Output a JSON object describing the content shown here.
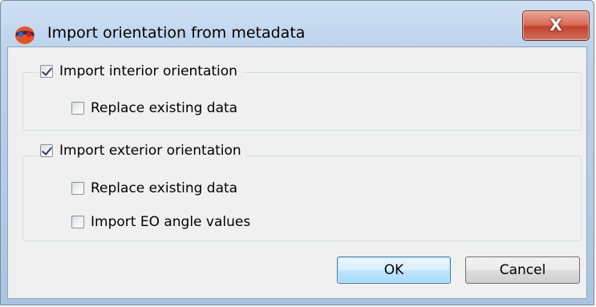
{
  "window": {
    "title": "Import orientation from metadata",
    "close_label": "X"
  },
  "groups": {
    "interior": {
      "label": "Import interior orientation",
      "checked": true,
      "options": [
        {
          "label": "Replace existing data",
          "checked": false
        }
      ]
    },
    "exterior": {
      "label": "Import exterior orientation",
      "checked": true,
      "options": [
        {
          "label": "Replace existing data",
          "checked": false
        },
        {
          "label": "Import EO angle values",
          "checked": false
        }
      ]
    }
  },
  "buttons": {
    "ok_label": "OK",
    "cancel_label": "Cancel"
  }
}
